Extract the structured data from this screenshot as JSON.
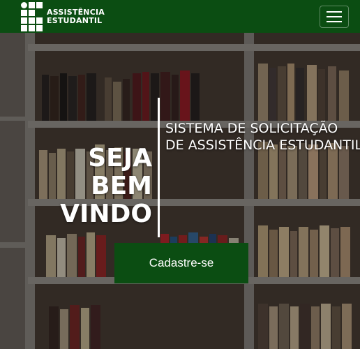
{
  "navbar": {
    "brand_line1": "ASSISTÊNCIA",
    "brand_line2": "ESTUDANTIL",
    "logo_icon": "if-logo-icon",
    "menu_icon": "hamburger-menu-icon",
    "background_color": "#0b4d12"
  },
  "hero": {
    "welcome_line1": "SEJA",
    "welcome_line2": "BEM VINDO",
    "system_title_line1": "SISTEMA DE SOLICITAÇÃO",
    "system_title_line2": "DE ASSISTÊNCIA ESTUDANTIL",
    "cta_label": "Cadastre-se",
    "cta_color": "#0b4d12"
  }
}
